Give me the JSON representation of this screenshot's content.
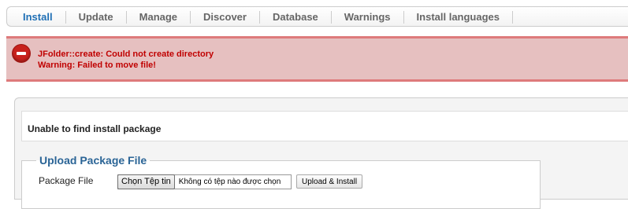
{
  "tabs": [
    {
      "label": "Install"
    },
    {
      "label": "Update"
    },
    {
      "label": "Manage"
    },
    {
      "label": "Discover"
    },
    {
      "label": "Database"
    },
    {
      "label": "Warnings"
    },
    {
      "label": "Install languages"
    }
  ],
  "active_tab": "Install",
  "error": {
    "icon": "error-stop-icon",
    "messages": [
      "JFolder::create: Could not create directory",
      "Warning: Failed to move file!"
    ]
  },
  "main": {
    "message": "Unable to find install package",
    "upload": {
      "legend": "Upload Package File",
      "field_label": "Package File",
      "choose_button": "Chọn Tệp tin",
      "no_file_text": "Không có tệp nào được chọn",
      "submit_label": "Upload & Install"
    }
  },
  "colors": {
    "active_tab": "#1f6fb5",
    "error_bg": "#e6c0c0",
    "error_border": "#de7a7b",
    "error_text": "#c00000",
    "legend": "#2a6496"
  }
}
